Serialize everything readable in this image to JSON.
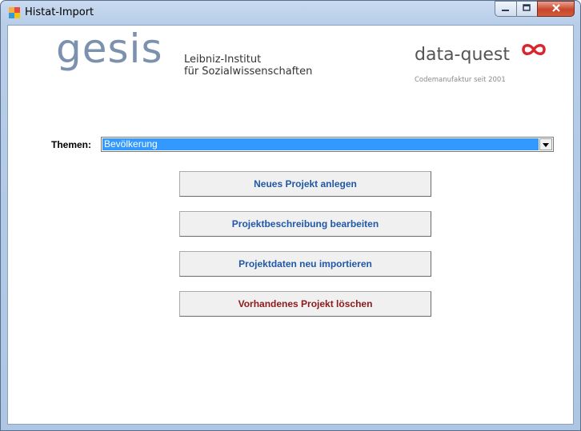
{
  "window": {
    "title": "Histat-Import",
    "controls": [
      "minimize-icon",
      "maximize-icon",
      "close-icon"
    ]
  },
  "header": {
    "gesis_logo": "gesis",
    "leibniz_line1": "Leibniz-Institut",
    "leibniz_line2": "für Sozialwissenschaften",
    "dataquest_logo": "data-quest",
    "dataquest_tagline": "Codemanufaktur seit 2001"
  },
  "themen": {
    "label": "Themen:",
    "selected": "Bevölkerung"
  },
  "buttons": {
    "new_project": "Neues Projekt anlegen",
    "edit_description": "Projektbeschreibung bearbeiten",
    "reimport": "Projektdaten neu importieren",
    "delete_project": "Vorhandenes Projekt löschen"
  },
  "colors": {
    "button_text_blue": "#2158a8",
    "button_text_red": "#8b1a1a",
    "selection": "#3399ff",
    "gesis_gray_blue": "#7b91ad",
    "dataquest_red": "#d7262e"
  }
}
